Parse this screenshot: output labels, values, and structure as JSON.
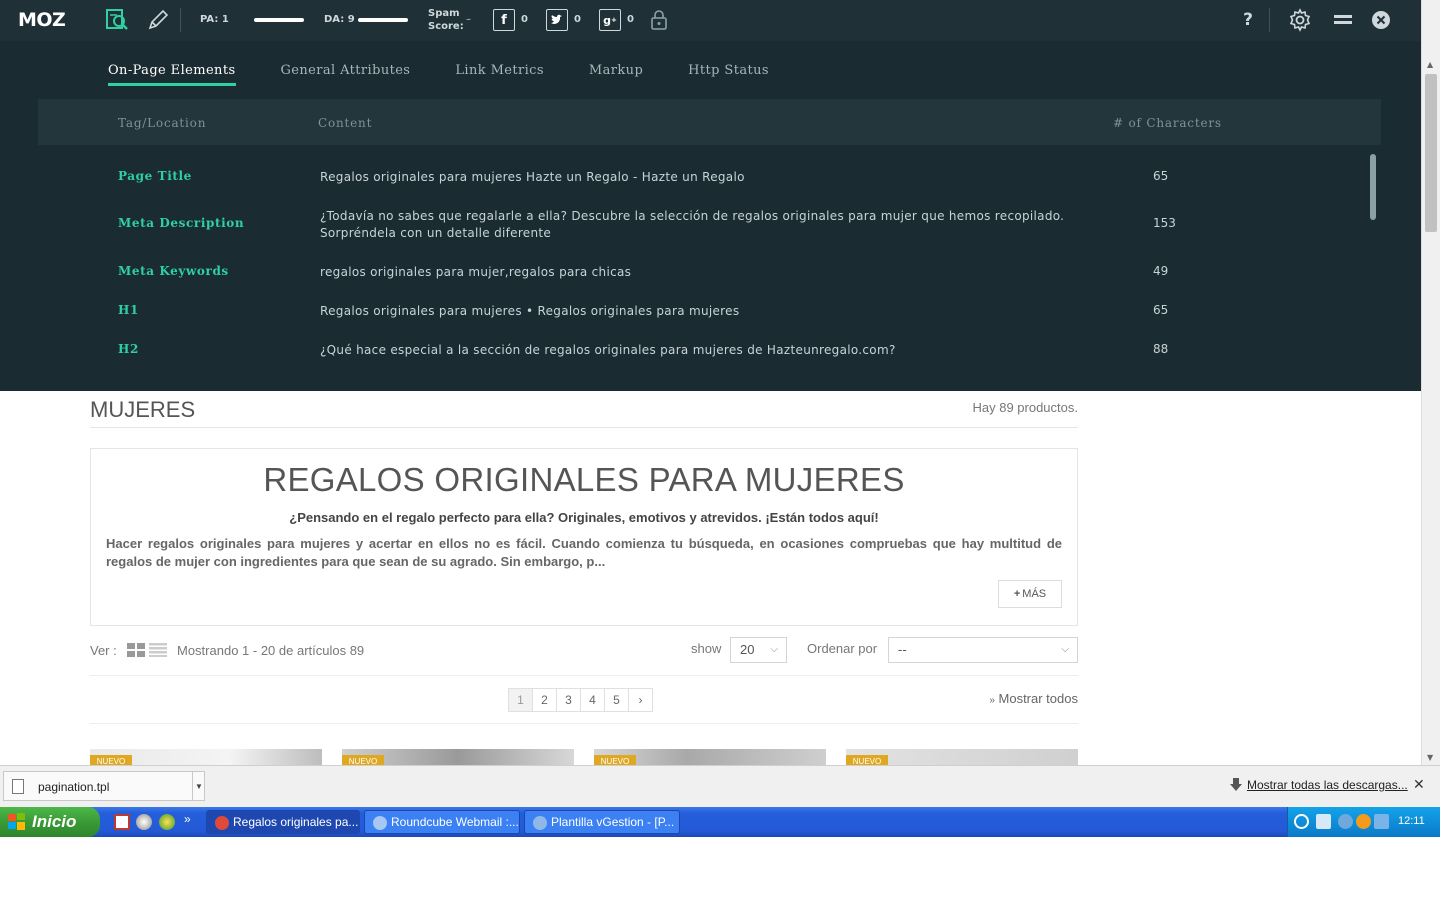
{
  "moz": {
    "logo": "MOZ",
    "pa_label": "PA: 1",
    "pa_fill": 1,
    "da_label": "DA: 9",
    "da_fill": 9,
    "spam_label_line1": "Spam",
    "spam_label_line2": "Score:",
    "spam_value": "–",
    "facebook_count": "0",
    "twitter_count": "0",
    "gplus_count": "0",
    "help": "?"
  },
  "panel": {
    "tabs": [
      {
        "label": "On-Page Elements",
        "active": true
      },
      {
        "label": "General Attributes",
        "active": false
      },
      {
        "label": "Link Metrics",
        "active": false
      },
      {
        "label": "Markup",
        "active": false
      },
      {
        "label": "Http Status",
        "active": false
      }
    ],
    "columns": {
      "tag": "Tag/Location",
      "content": "Content",
      "chars": "# of Characters"
    },
    "rows": [
      {
        "tag": "Page Title",
        "content": "Regalos originales para mujeres Hazte un Regalo - Hazte un Regalo",
        "chars": "65"
      },
      {
        "tag": "Meta Description",
        "content": "¿Todavía no sabes que regalarle a ella? Descubre la selección de regalos originales para mujer que hemos recopilado. Sorpréndela con un detalle diferente",
        "chars": "153"
      },
      {
        "tag": "Meta Keywords",
        "content": "regalos originales para mujer,regalos para chicas",
        "chars": "49"
      },
      {
        "tag": "H1",
        "content": "Regalos originales para mujeres • Regalos originales para mujeres",
        "chars": "65"
      },
      {
        "tag": "H2",
        "content": "¿Qué hace especial a la sección de regalos originales para mujeres de Hazteunregalo.com?",
        "chars": "88"
      }
    ]
  },
  "page": {
    "category_title": "MUJERES",
    "product_count": "Hay 89 productos.",
    "heading": "REGALOS ORIGINALES PARA MUJERES",
    "subheading": "¿Pensando en el regalo perfecto para ella? Originales, emotivos y atrevidos. ¡Están todos aquí!",
    "description": "Hacer regalos originales para mujeres y acertar en ellos no es fácil. Cuando comienza tu búsqueda, en ocasiones compruebas que hay multitud de regalos de mujer con ingredientes para que sean de su agrado. Sin embargo, p...",
    "mas_button": "MÁS",
    "ver_label": "Ver :",
    "showing_text": "Mostrando 1 - 20 de artículos 89",
    "show_label": "show",
    "show_value": "20",
    "order_label": "Ordenar por",
    "order_value": "--",
    "pages": [
      "1",
      "2",
      "3",
      "4",
      "5"
    ],
    "next": "›",
    "show_all": "Mostrar todos",
    "product_badge": "NUEVO"
  },
  "downloads": {
    "file_name": "pagination.tpl",
    "show_all": "Mostrar todas las descargas...",
    "close": "✕"
  },
  "taskbar": {
    "start_label": "Inicio",
    "tasks": [
      {
        "label": "Regalos originales pa...",
        "active": true,
        "icon_color": "#e04a3a"
      },
      {
        "label": "Roundcube Webmail :...",
        "active": false,
        "icon_color": "#a7c7f2"
      },
      {
        "label": "Plantilla vGestion - [P...",
        "active": false,
        "icon_color": "#8fb8e8"
      }
    ],
    "clock": "12:11"
  }
}
